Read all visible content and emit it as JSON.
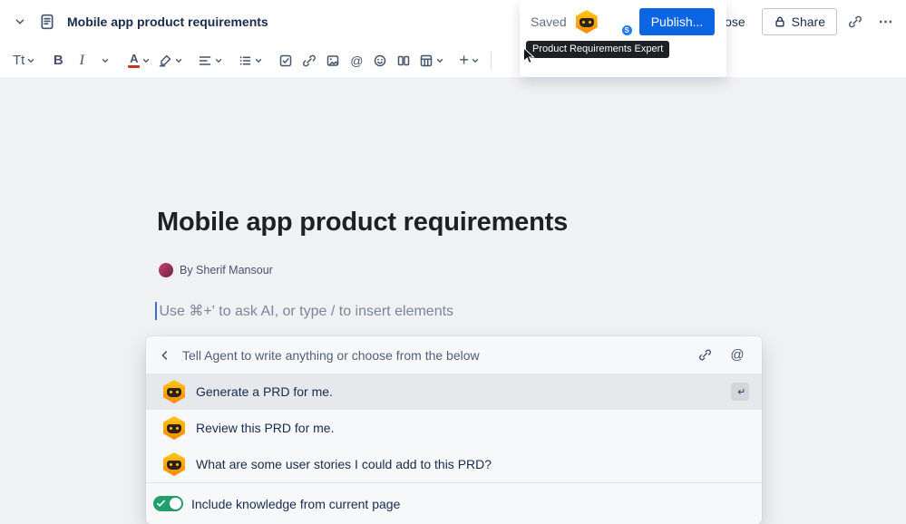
{
  "topbar": {
    "doc_title": "Mobile app product requirements",
    "saved_label": "Saved",
    "publish_label": "Publish...",
    "close_label": "Close",
    "share_label": "Share",
    "more_glyph": "⋯",
    "avatar_badge": "S",
    "agent_tooltip": "Product Requirements Expert"
  },
  "toolbar": {
    "text_style_glyph": "Tt",
    "bold_glyph": "B",
    "italic_glyph": "I",
    "text_color_glyph": "A",
    "mention_glyph": "@",
    "plus_glyph": "+"
  },
  "content": {
    "page_title": "Mobile app product requirements",
    "byline": "By Sherif Mansour",
    "placeholder": "Use ⌘+' to ask AI, or type / to insert elements"
  },
  "agent_panel": {
    "prompt": "Tell Agent to write anything or choose from the below",
    "mention_glyph": "@",
    "items": [
      "Generate a PRD for me.",
      "Review this PRD for me.",
      "What are some user stories I could add to this PRD?"
    ],
    "footer_toggle_label": "Include knowledge from current page",
    "toggle_on": true
  },
  "colors": {
    "accent_blue": "#0C66E4",
    "toggle_green": "#22A06B",
    "agent_hex_top": "#FFC716",
    "agent_hex_bottom": "#F68909",
    "tooltip_bg": "#1D2125"
  }
}
